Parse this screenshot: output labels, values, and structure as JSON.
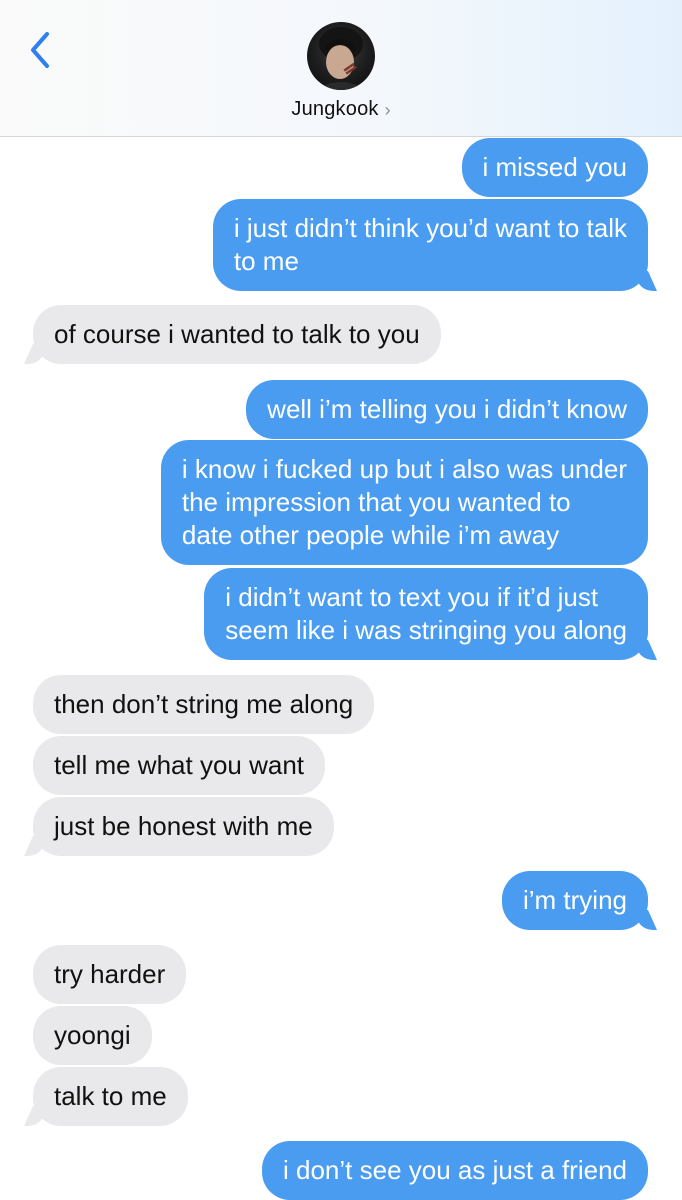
{
  "header": {
    "contact_name": "Jungkook",
    "chevron": "›",
    "avatar_icon": "contact-photo"
  },
  "colors": {
    "sent_bubble": "#4a9cf1",
    "received_bubble": "#e9e9eb",
    "back_arrow": "#2f7ff0"
  },
  "messages": [
    {
      "from": "me",
      "lines": [
        "i missed you"
      ]
    },
    {
      "from": "me",
      "lines": [
        "i just didn’t think you’d want to talk",
        "to me"
      ]
    },
    {
      "from": "them",
      "lines": [
        "of course i wanted to talk to you"
      ]
    },
    {
      "from": "me",
      "lines": [
        "well i’m telling you i didn’t know"
      ]
    },
    {
      "from": "me",
      "lines": [
        "i know i fucked up but i also was under",
        "the impression that you wanted to",
        "date other people while i’m away"
      ]
    },
    {
      "from": "me",
      "lines": [
        "i didn’t want to text you if it’d just",
        "seem like i was stringing you along"
      ]
    },
    {
      "from": "them",
      "lines": [
        "then don’t string me along"
      ]
    },
    {
      "from": "them",
      "lines": [
        "tell me what you want"
      ]
    },
    {
      "from": "them",
      "lines": [
        "just be honest with me"
      ]
    },
    {
      "from": "me",
      "lines": [
        "i’m trying"
      ]
    },
    {
      "from": "them",
      "lines": [
        "try harder"
      ]
    },
    {
      "from": "them",
      "lines": [
        "yoongi"
      ]
    },
    {
      "from": "them",
      "lines": [
        "talk to me"
      ]
    },
    {
      "from": "me",
      "lines": [
        "i don’t see you as just a friend"
      ]
    }
  ]
}
